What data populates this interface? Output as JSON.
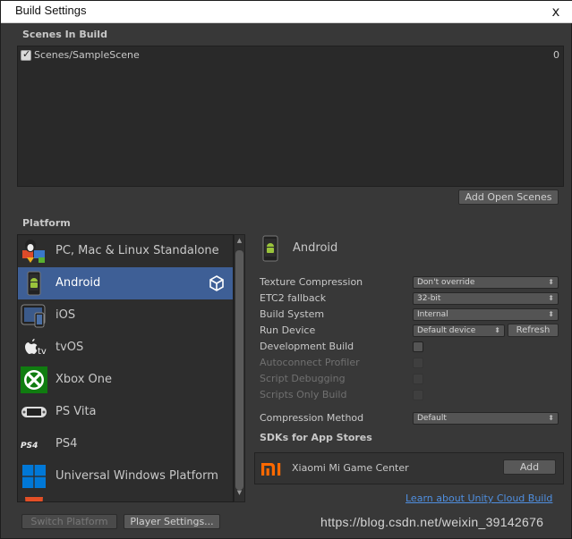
{
  "window": {
    "title": "Build Settings",
    "close_glyph": "x"
  },
  "scenes": {
    "header": "Scenes In Build",
    "items": [
      {
        "path": "Scenes/SampleScene",
        "index": "0",
        "checked": true
      }
    ],
    "add_open_scenes_label": "Add Open Scenes"
  },
  "platform": {
    "header": "Platform",
    "items": [
      {
        "label": "PC, Mac & Linux Standalone",
        "icon": "pc-mac-linux-icon"
      },
      {
        "label": "Android",
        "icon": "android-icon",
        "selected": true
      },
      {
        "label": "iOS",
        "icon": "ios-icon"
      },
      {
        "label": "tvOS",
        "icon": "tvos-icon"
      },
      {
        "label": "Xbox One",
        "icon": "xbox-icon"
      },
      {
        "label": "PS Vita",
        "icon": "ps-vita-icon"
      },
      {
        "label": "PS4",
        "icon": "ps4-icon"
      },
      {
        "label": "Universal Windows Platform",
        "icon": "windows-icon"
      }
    ],
    "switch_platform_label": "Switch Platform",
    "player_settings_label": "Player Settings..."
  },
  "settings": {
    "platform_title": "Android",
    "texture_compression": {
      "label": "Texture Compression",
      "value": "Don't override"
    },
    "etc2_fallback": {
      "label": "ETC2 fallback",
      "value": "32-bit"
    },
    "build_system": {
      "label": "Build System",
      "value": "Internal"
    },
    "run_device": {
      "label": "Run Device",
      "value": "Default device",
      "refresh_label": "Refresh"
    },
    "development_build": {
      "label": "Development Build"
    },
    "autoconnect_profiler": {
      "label": "Autoconnect Profiler"
    },
    "script_debugging": {
      "label": "Script Debugging"
    },
    "scripts_only_build": {
      "label": "Scripts Only Build"
    },
    "compression_method": {
      "label": "Compression Method",
      "value": "Default"
    }
  },
  "sdks": {
    "header": "SDKs for App Stores",
    "items": [
      {
        "name": "Xiaomi Mi Game Center",
        "add_label": "Add"
      }
    ],
    "cloud_build_link": "Learn about Unity Cloud Build"
  },
  "watermark": "https://blog.csdn.net/weixin_39142676",
  "colors": {
    "selected_row": "#3e5f96",
    "link": "#4f8fe0",
    "xbox_green": "#107c10",
    "mi_orange": "#ff6900",
    "windows_blue": "#0078d7"
  }
}
